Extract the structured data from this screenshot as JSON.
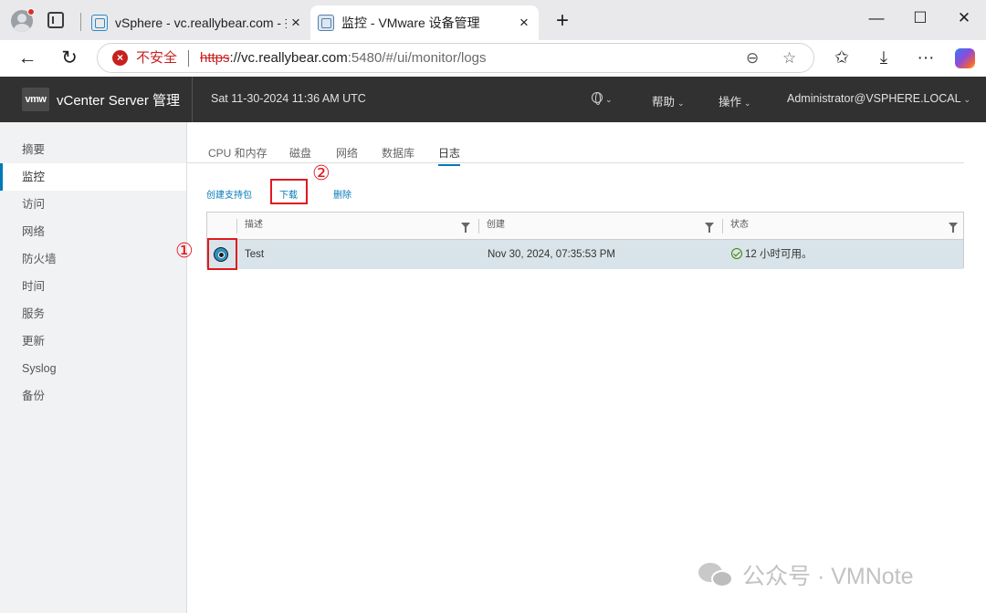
{
  "browser": {
    "tabs": [
      {
        "title": "vSphere - vc.reallybear.com - 摘要",
        "close": "×"
      },
      {
        "title": "监控 - VMware 设备管理",
        "close": "×"
      }
    ],
    "new_tab": "+",
    "window_controls": {
      "minimize": "—",
      "maximize": "☐",
      "close": "✕"
    },
    "nav": {
      "back": "←",
      "reload": "↻"
    },
    "security_warning": "不安全",
    "url": {
      "scheme": "https",
      "host": "://vc.reallybear.com",
      "rest": ":5480/#/ui/monitor/logs"
    },
    "toolbar_glyphs": {
      "zoom": "⊖",
      "favorite": "☆",
      "favorites_list": "✩",
      "downloads": "⤓",
      "more": "···"
    }
  },
  "header": {
    "logo": "vmw",
    "product": "vCenter Server 管理",
    "datetime": "Sat 11-30-2024 11:36 AM UTC",
    "help": "帮助",
    "actions": "操作",
    "user": "Administrator@VSPHERE.LOCAL",
    "caret": "⌄"
  },
  "sidebar": {
    "items": [
      "摘要",
      "监控",
      "访问",
      "网络",
      "防火墙",
      "时间",
      "服务",
      "更新",
      "Syslog",
      "备份"
    ],
    "active": "监控"
  },
  "subtabs": [
    "CPU 和内存",
    "磁盘",
    "网络",
    "数据库",
    "日志"
  ],
  "active_subtab": "日志",
  "actions": {
    "create": "创建支持包",
    "download": "下载",
    "delete": "删除"
  },
  "annotations": {
    "one": "①",
    "two": "②"
  },
  "grid": {
    "columns": [
      "描述",
      "创建",
      "状态"
    ],
    "rows": [
      {
        "description": "Test",
        "created": "Nov 30, 2024, 07:35:53 PM",
        "status": "12 小时可用。",
        "selected": true
      }
    ]
  },
  "watermark": "公众号 · VMNote",
  "colors": {
    "accent": "#0079b8",
    "annotation": "#e0191f",
    "header": "#313131",
    "row_selected": "#d9e4ea"
  }
}
